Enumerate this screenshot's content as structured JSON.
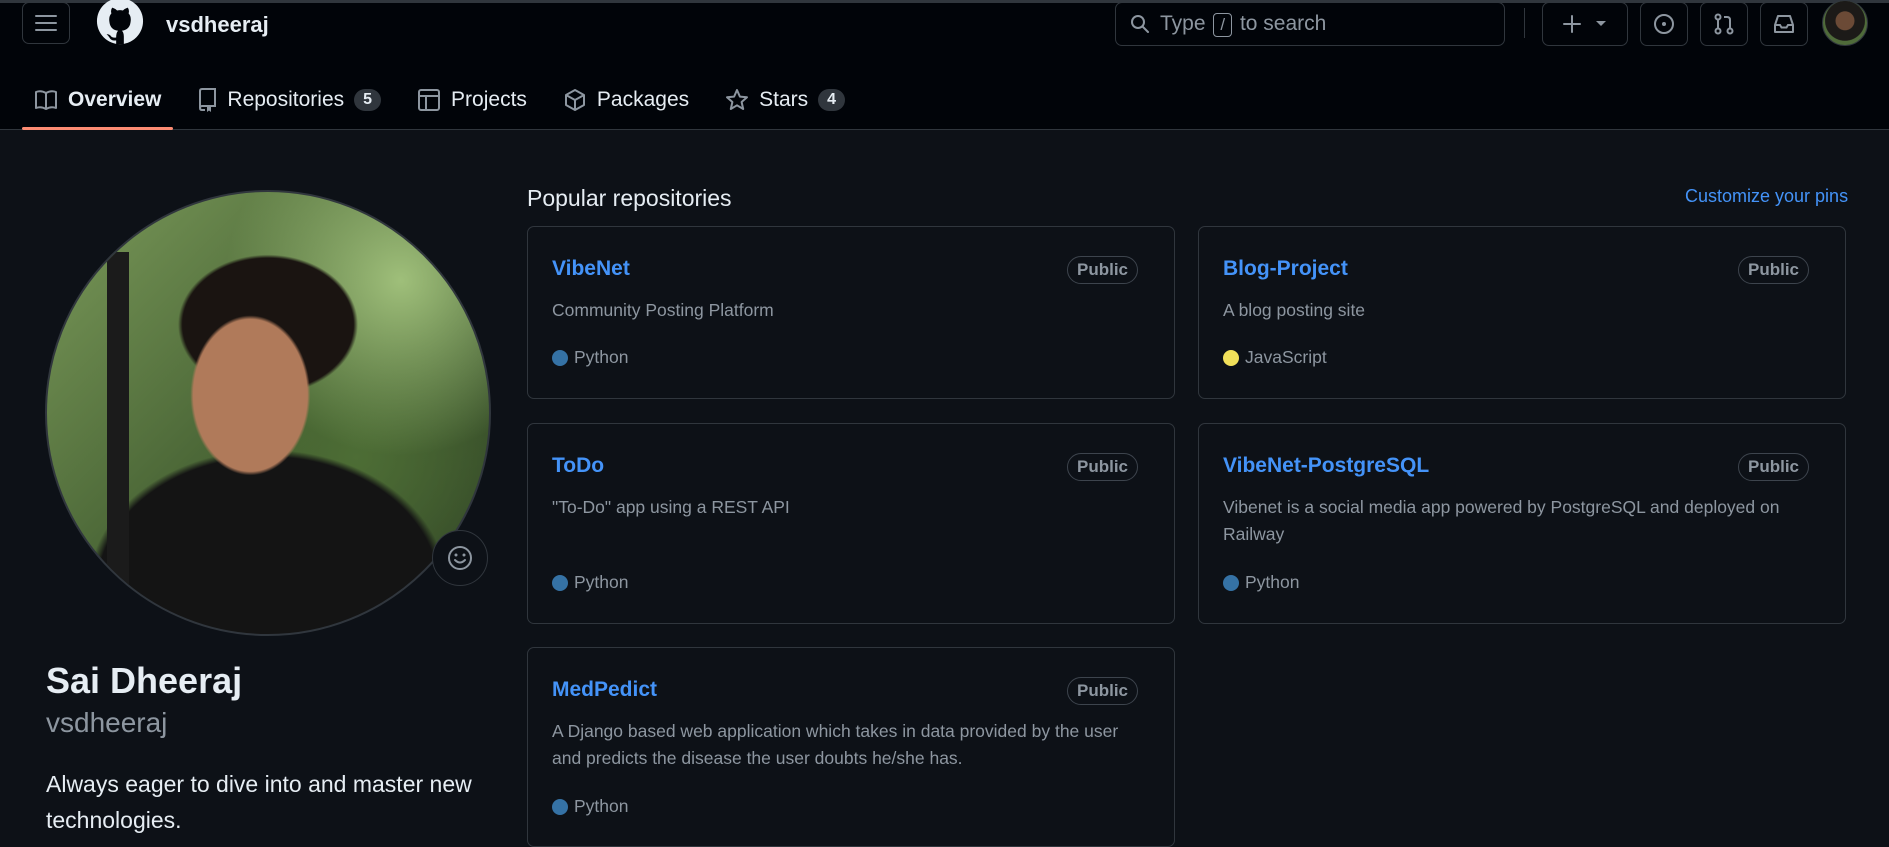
{
  "header": {
    "username": "vsdheeraj",
    "search": {
      "prefix": "Type",
      "key": "/",
      "suffix": "to search"
    }
  },
  "tabs": [
    {
      "label": "Overview",
      "count": null
    },
    {
      "label": "Repositories",
      "count": "5"
    },
    {
      "label": "Projects",
      "count": null
    },
    {
      "label": "Packages",
      "count": null
    },
    {
      "label": "Stars",
      "count": "4"
    }
  ],
  "profile": {
    "full_name": "Sai Dheeraj",
    "login": "vsdheeraj",
    "bio": "Always eager to dive into and master new technologies."
  },
  "popular": {
    "title": "Popular repositories",
    "customize_label": "Customize your pins",
    "repos": [
      {
        "name": "VibeNet",
        "visibility": "Public",
        "description": "Community Posting Platform",
        "language": "Python",
        "language_color": "#3572A5"
      },
      {
        "name": "Blog-Project",
        "visibility": "Public",
        "description": "A blog posting site",
        "language": "JavaScript",
        "language_color": "#f1e05a"
      },
      {
        "name": "ToDo",
        "visibility": "Public",
        "description": "\"To-Do\" app using a REST API",
        "language": "Python",
        "language_color": "#3572A5"
      },
      {
        "name": "VibeNet-PostgreSQL",
        "visibility": "Public",
        "description": "Vibenet is a social media app powered by PostgreSQL and deployed on Railway",
        "language": "Python",
        "language_color": "#3572A5"
      },
      {
        "name": "MedPedict",
        "visibility": "Public",
        "description": "A Django based web application which takes in data provided by the user and predicts the disease the user doubts he/she has.",
        "language": "Python",
        "language_color": "#3572A5"
      }
    ]
  },
  "colors": {
    "accent": "#4493f8",
    "tab_underline": "#fd8c73",
    "background": "#0d1117",
    "header_background": "#010409"
  }
}
